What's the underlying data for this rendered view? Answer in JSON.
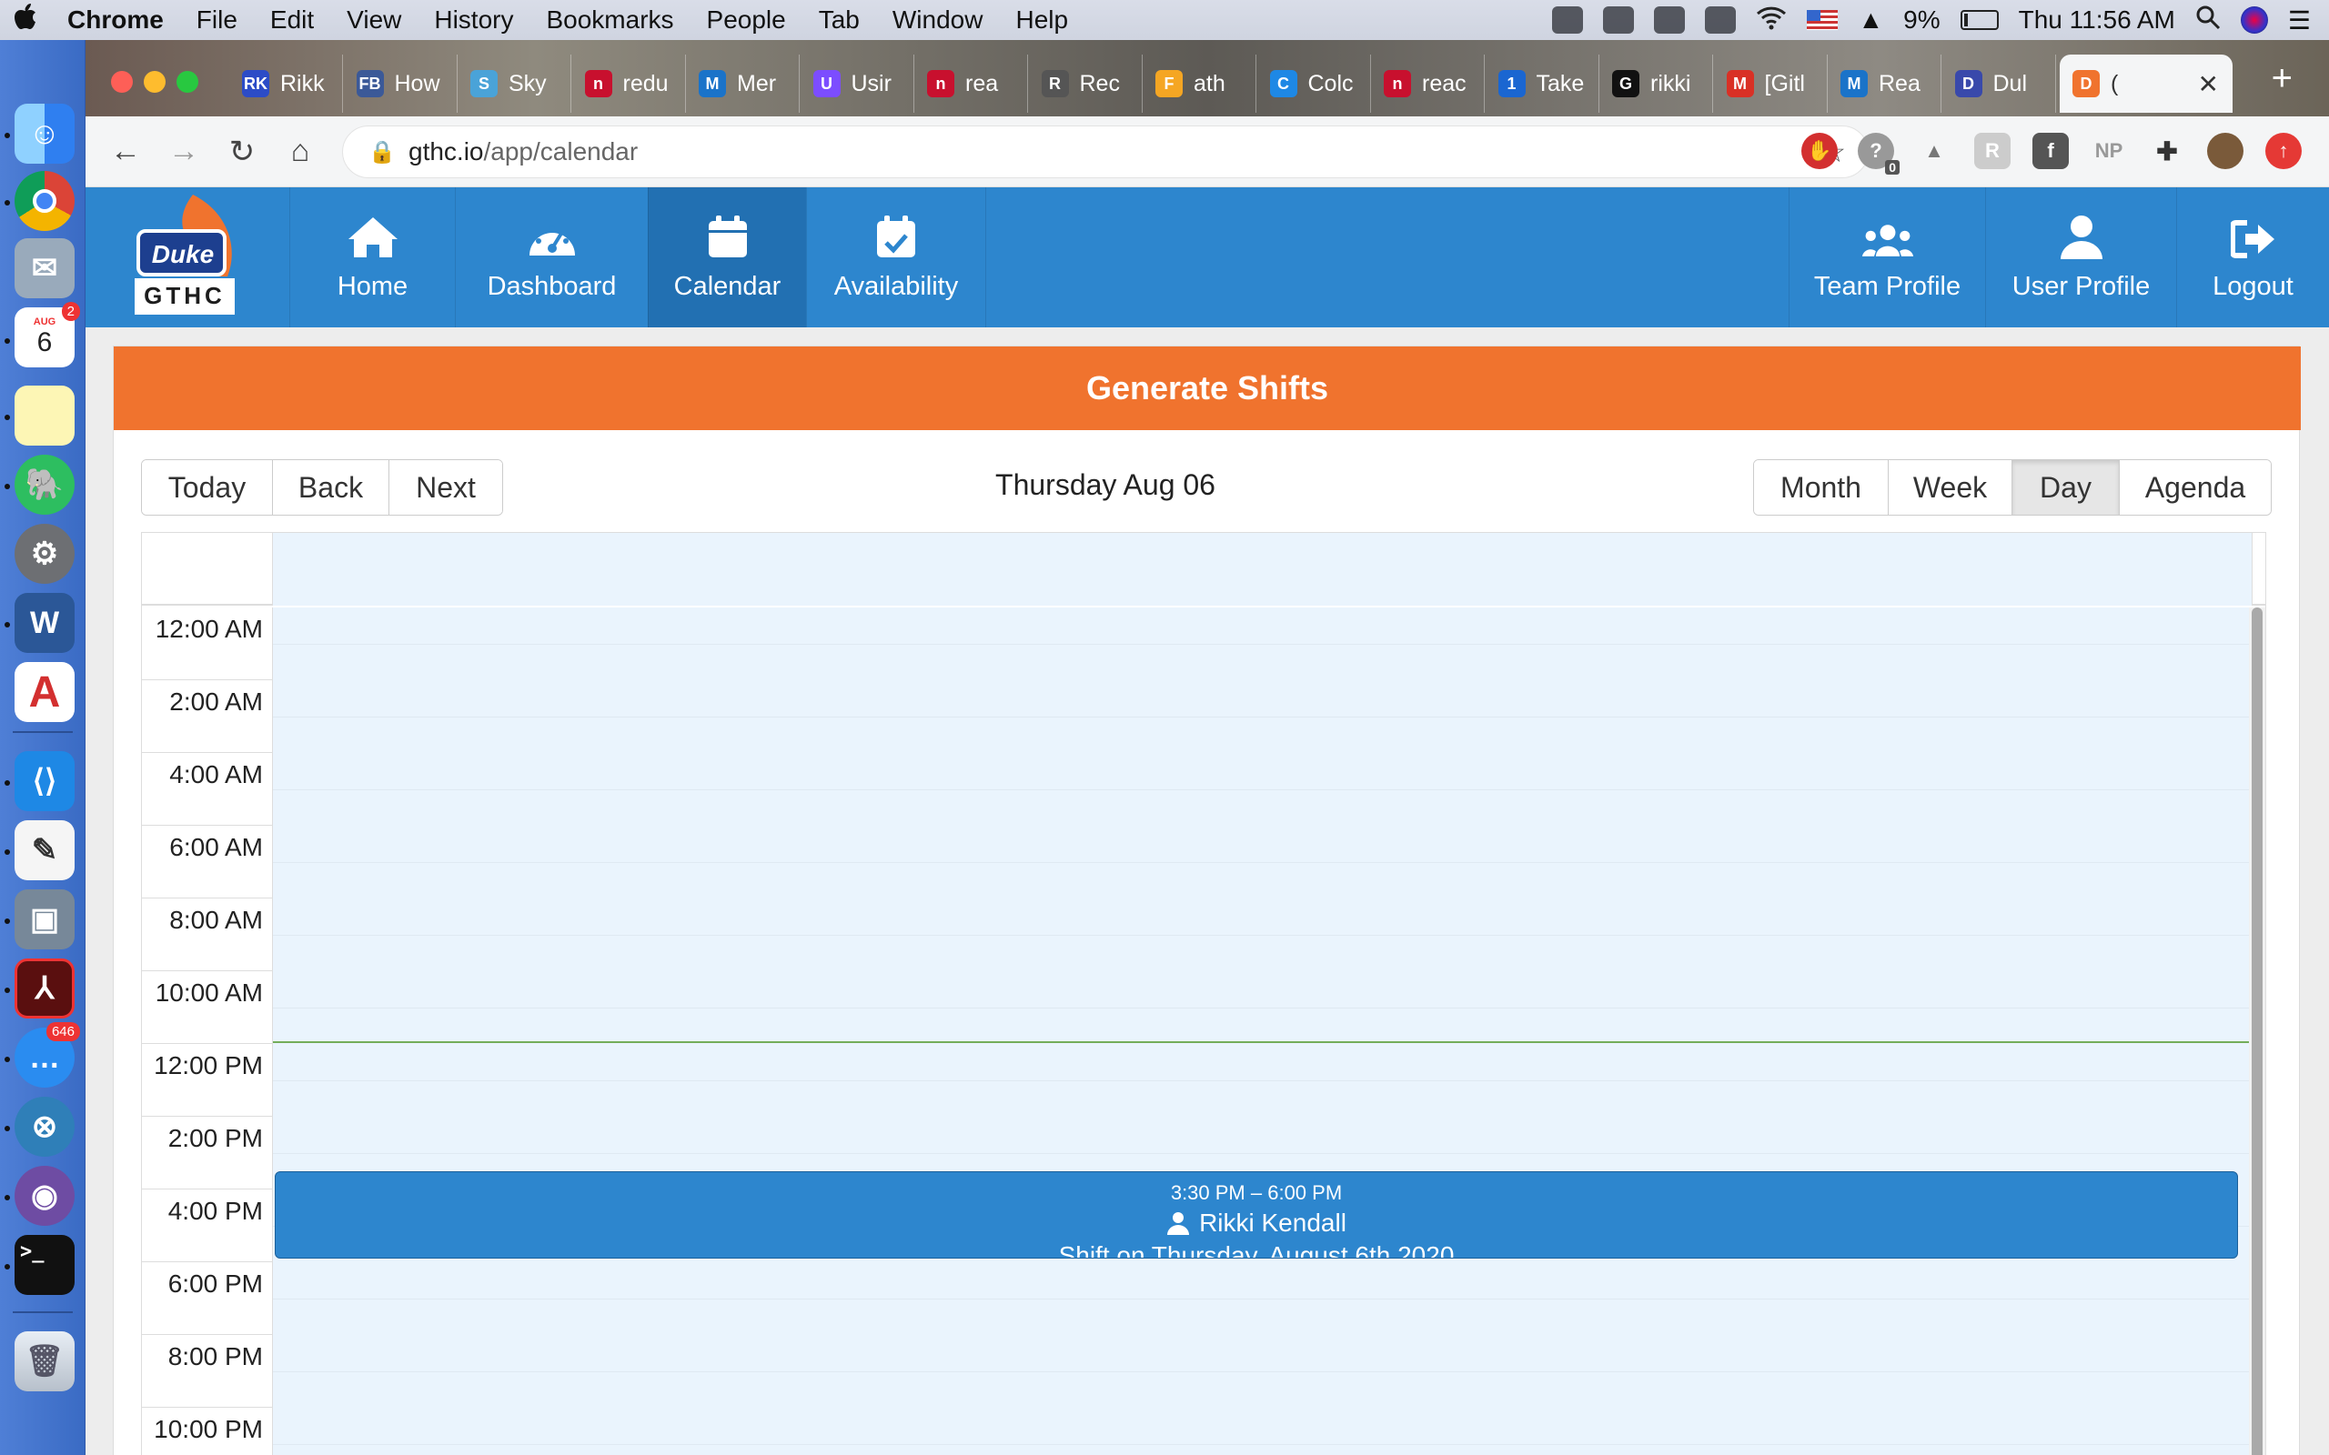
{
  "menubar": {
    "apple": "",
    "items": [
      "Chrome",
      "File",
      "Edit",
      "View",
      "History",
      "Bookmarks",
      "People",
      "Tab",
      "Window",
      "Help"
    ],
    "battery": "9%",
    "clock": "Thu 11:56 AM"
  },
  "dock": {
    "calendar_month": "AUG",
    "calendar_day": "6",
    "calendar_badge": "2",
    "messages_badge": "646"
  },
  "browser": {
    "tabs": [
      {
        "label": "Rikk",
        "icon": "RK",
        "color": "#2c4cc7"
      },
      {
        "label": "How",
        "icon": "FB",
        "color": "#3b5998"
      },
      {
        "label": "Sky",
        "icon": "S",
        "color": "#4aa3d8"
      },
      {
        "label": "redu",
        "icon": "n",
        "color": "#c8102e"
      },
      {
        "label": "Mer",
        "icon": "M",
        "color": "#1a73c9"
      },
      {
        "label": "Usir",
        "icon": "U",
        "color": "#7c4dff"
      },
      {
        "label": "rea",
        "icon": "n",
        "color": "#c8102e"
      },
      {
        "label": "Rec",
        "icon": "R",
        "color": "#555"
      },
      {
        "label": "ath",
        "icon": "F",
        "color": "#f5a623"
      },
      {
        "label": "Colc",
        "icon": "C",
        "color": "#1e88e5"
      },
      {
        "label": "reac",
        "icon": "n",
        "color": "#c8102e"
      },
      {
        "label": "Take",
        "icon": "1",
        "color": "#1a66d1"
      },
      {
        "label": "rikki",
        "icon": "G",
        "color": "#111"
      },
      {
        "label": "[Gitl",
        "icon": "M",
        "color": "#d93025"
      },
      {
        "label": "Rea",
        "icon": "M",
        "color": "#1a73c9"
      },
      {
        "label": "Dul",
        "icon": "D",
        "color": "#3949ab"
      }
    ],
    "active_tab": {
      "label": "(",
      "close": "✕"
    },
    "new_tab": "+",
    "url_host": "gthc.io",
    "url_path": "/app/calendar",
    "ext_np": "NP",
    "ext_badge": "0"
  },
  "appnav": {
    "logo_top": "Duke",
    "logo_bottom": "GTHC",
    "left": [
      {
        "label": "Home",
        "icon": "home-icon"
      },
      {
        "label": "Dashboard",
        "icon": "gauge-icon"
      },
      {
        "label": "Calendar",
        "icon": "calendar-icon"
      },
      {
        "label": "Availability",
        "icon": "calendar-check-icon"
      }
    ],
    "right": [
      {
        "label": "Team Profile",
        "icon": "users-icon"
      },
      {
        "label": "User Profile",
        "icon": "user-icon"
      },
      {
        "label": "Logout",
        "icon": "logout-icon"
      }
    ],
    "active": "Calendar"
  },
  "calendar": {
    "generate_label": "Generate Shifts",
    "nav_buttons": [
      "Today",
      "Back",
      "Next"
    ],
    "date_label": "Thursday Aug 06",
    "views": [
      "Month",
      "Week",
      "Day",
      "Agenda"
    ],
    "active_view": "Day",
    "time_slots": [
      "12:00 AM",
      "2:00 AM",
      "4:00 AM",
      "6:00 AM",
      "8:00 AM",
      "10:00 AM",
      "12:00 PM",
      "2:00 PM",
      "4:00 PM",
      "6:00 PM",
      "8:00 PM",
      "10:00 PM"
    ],
    "event": {
      "time": "3:30 PM – 6:00 PM",
      "person": "Rikki Kendall",
      "description": "Shift on Thursday, August 6th 2020"
    },
    "colors": {
      "nav": "#2d86ce",
      "generate": "#f0732e",
      "event": "#2d86ce",
      "now_line": "#74ad5a"
    }
  }
}
